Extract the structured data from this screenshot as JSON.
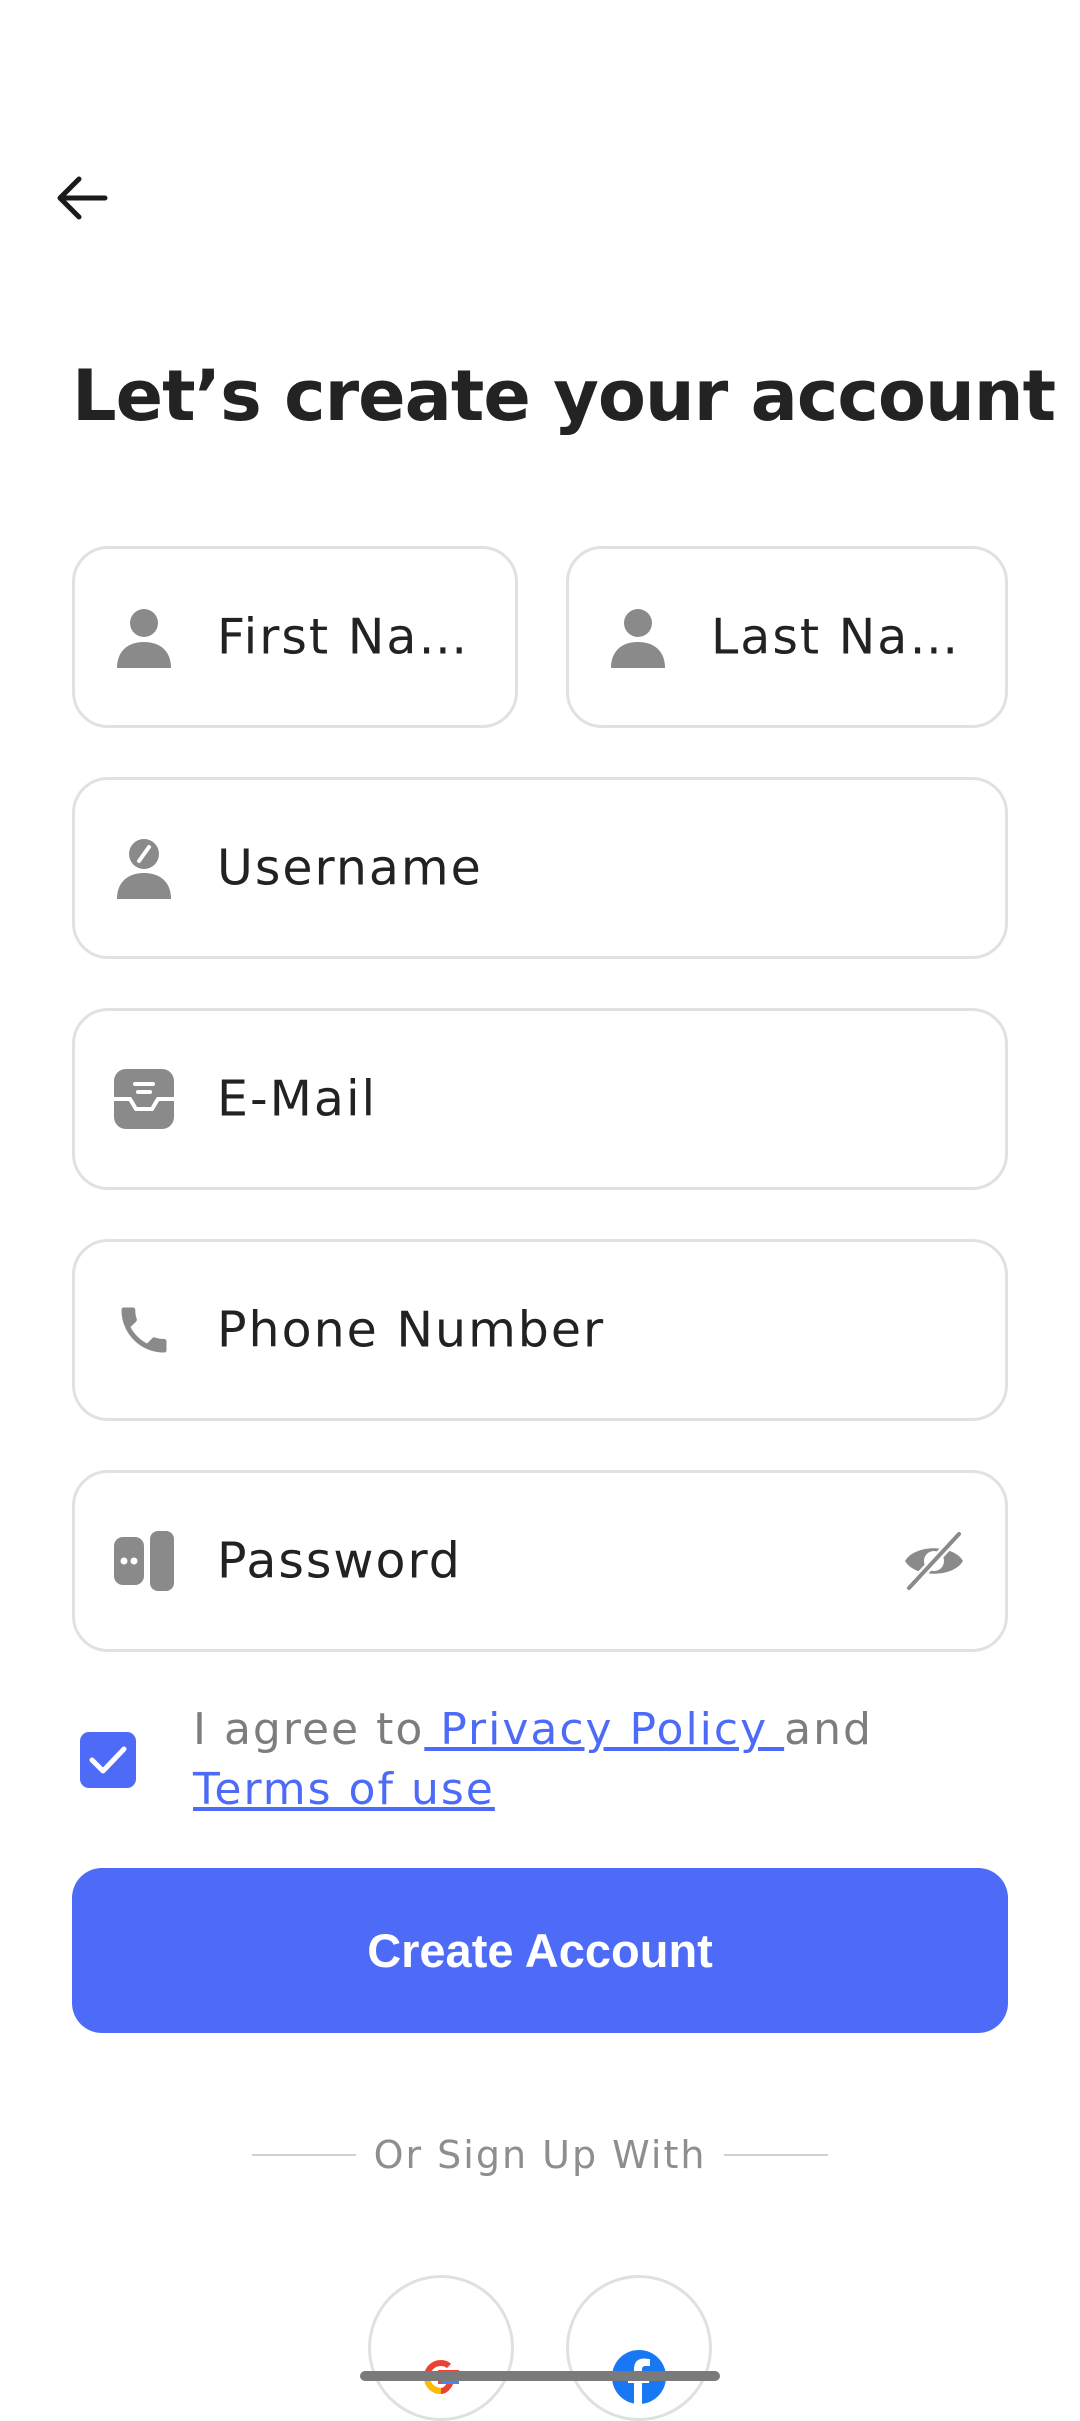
{
  "header": {
    "title": "Let’s create your account"
  },
  "form": {
    "first_name": {
      "placeholder": "First Na…",
      "icon": "person-icon"
    },
    "last_name": {
      "placeholder": "Last Na…",
      "icon": "person-icon"
    },
    "username": {
      "placeholder": "Username",
      "icon": "user-edit-icon"
    },
    "email": {
      "placeholder": "E-Mail",
      "icon": "inbox-icon"
    },
    "phone": {
      "placeholder": "Phone Number",
      "icon": "phone-icon"
    },
    "password": {
      "placeholder": "Password",
      "icon": "password-check-icon",
      "toggle_icon": "eye-slash-icon"
    }
  },
  "agreement": {
    "checked": true,
    "prefix": "I agree to",
    "privacy_link": " Privacy Policy ",
    "conjunction": "and",
    "terms_link": " Terms of use"
  },
  "actions": {
    "create_account_label": "Create Account"
  },
  "social": {
    "divider_text": "Or Sign Up With",
    "providers": [
      "google",
      "facebook"
    ]
  },
  "colors": {
    "accent": "#4E6BF8",
    "border": "#E1E1E1",
    "icon_gray": "#8A8A8A"
  }
}
